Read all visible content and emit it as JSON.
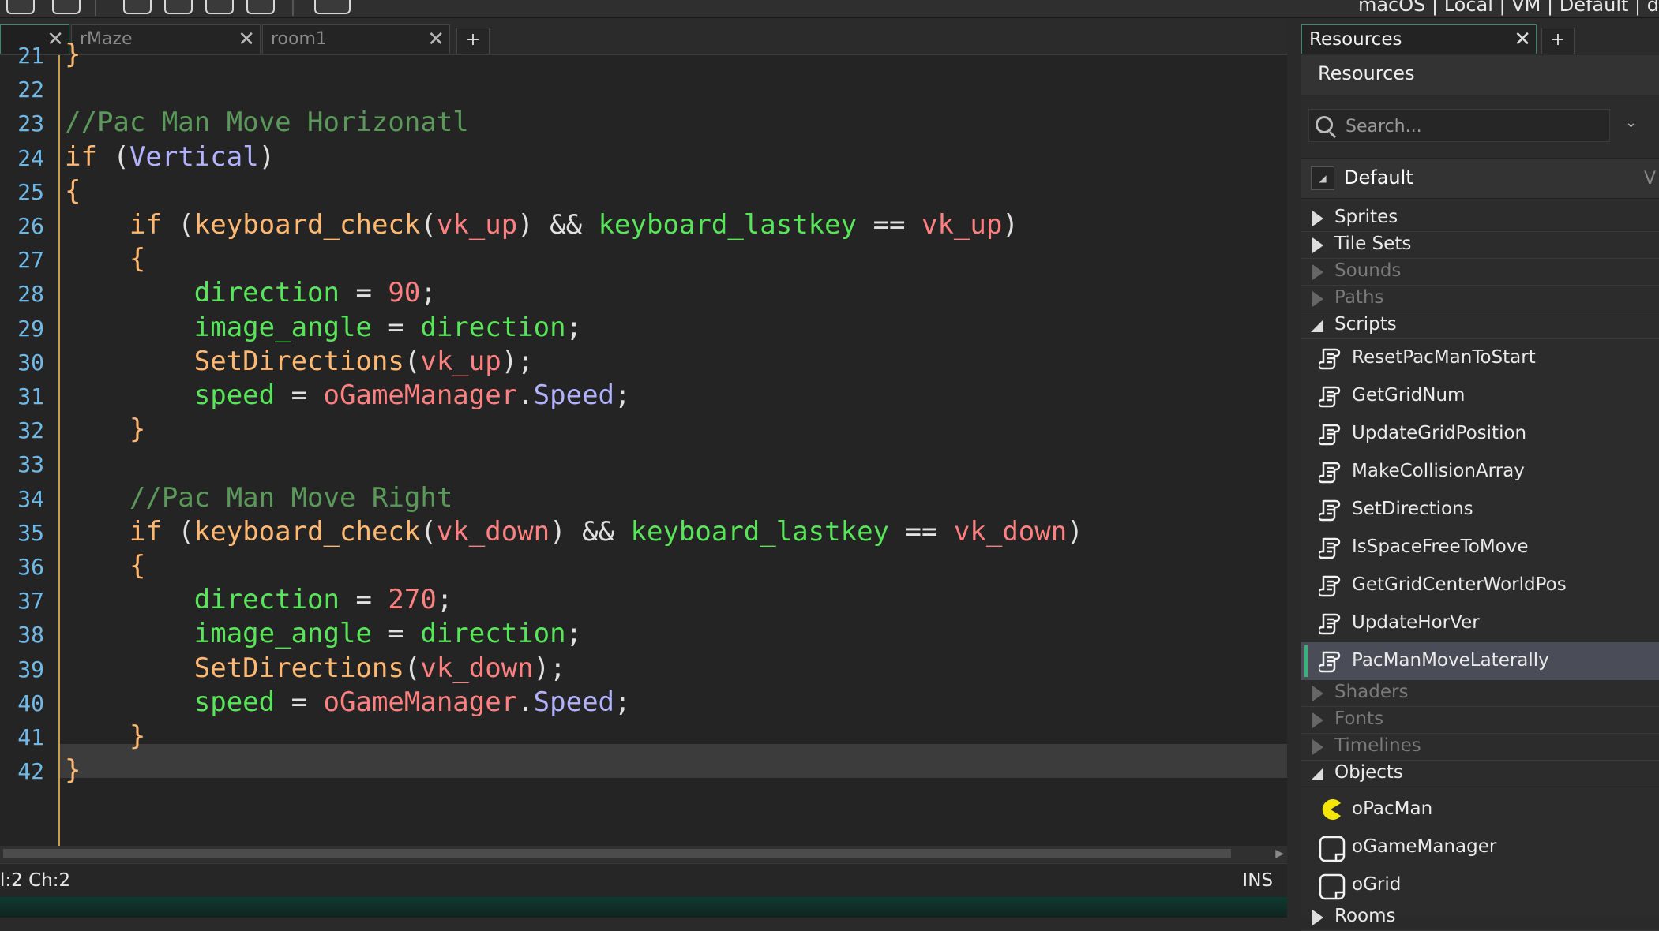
{
  "toolbar": {
    "status_text": "macOS | Local | VM | Default | d"
  },
  "tabs": [
    {
      "label": ""
    },
    {
      "label": "rMaze"
    },
    {
      "label": "room1"
    }
  ],
  "tab_add": "+",
  "code": {
    "lines": [
      {
        "n": "21",
        "tokens": [
          [
            "brk",
            "}"
          ]
        ]
      },
      {
        "n": "22",
        "tokens": []
      },
      {
        "n": "23",
        "tokens": [
          [
            "cmt",
            "//Pac Man Move Horizonatl"
          ]
        ]
      },
      {
        "n": "24",
        "tokens": [
          [
            "kw",
            "if"
          ],
          [
            "op",
            " ("
          ],
          [
            "inst",
            "Vertical"
          ],
          [
            "op",
            ")"
          ]
        ]
      },
      {
        "n": "25",
        "tokens": [
          [
            "brk",
            "{"
          ]
        ]
      },
      {
        "n": "26",
        "tokens": [
          [
            "op",
            "    "
          ],
          [
            "kw",
            "if"
          ],
          [
            "op",
            " ("
          ],
          [
            "fn",
            "keyboard_check"
          ],
          [
            "op",
            "("
          ],
          [
            "cst",
            "vk_up"
          ],
          [
            "op",
            ") && "
          ],
          [
            "var",
            "keyboard_lastkey"
          ],
          [
            "op",
            " == "
          ],
          [
            "cst",
            "vk_up"
          ],
          [
            "op",
            ")"
          ]
        ]
      },
      {
        "n": "27",
        "tokens": [
          [
            "op",
            "    "
          ],
          [
            "brk",
            "{"
          ]
        ]
      },
      {
        "n": "28",
        "tokens": [
          [
            "op",
            "        "
          ],
          [
            "var",
            "direction"
          ],
          [
            "op",
            " = "
          ],
          [
            "num",
            "90"
          ],
          [
            "op",
            ";"
          ]
        ]
      },
      {
        "n": "29",
        "tokens": [
          [
            "op",
            "        "
          ],
          [
            "var",
            "image_angle"
          ],
          [
            "op",
            " = "
          ],
          [
            "var",
            "direction"
          ],
          [
            "op",
            ";"
          ]
        ]
      },
      {
        "n": "30",
        "tokens": [
          [
            "op",
            "        "
          ],
          [
            "fn",
            "SetDirections"
          ],
          [
            "op",
            "("
          ],
          [
            "cst",
            "vk_up"
          ],
          [
            "op",
            ");"
          ]
        ]
      },
      {
        "n": "31",
        "tokens": [
          [
            "op",
            "        "
          ],
          [
            "var",
            "speed"
          ],
          [
            "op",
            " = "
          ],
          [
            "cst",
            "oGameManager"
          ],
          [
            "op",
            "."
          ],
          [
            "inst",
            "Speed"
          ],
          [
            "op",
            ";"
          ]
        ]
      },
      {
        "n": "32",
        "tokens": [
          [
            "op",
            "    "
          ],
          [
            "brk",
            "}"
          ]
        ]
      },
      {
        "n": "33",
        "tokens": []
      },
      {
        "n": "34",
        "tokens": [
          [
            "op",
            "    "
          ],
          [
            "cmt",
            "//Pac Man Move Right"
          ]
        ]
      },
      {
        "n": "35",
        "tokens": [
          [
            "op",
            "    "
          ],
          [
            "kw",
            "if"
          ],
          [
            "op",
            " ("
          ],
          [
            "fn",
            "keyboard_check"
          ],
          [
            "op",
            "("
          ],
          [
            "cst",
            "vk_down"
          ],
          [
            "op",
            ") && "
          ],
          [
            "var",
            "keyboard_lastkey"
          ],
          [
            "op",
            " == "
          ],
          [
            "cst",
            "vk_down"
          ],
          [
            "op",
            ")"
          ]
        ]
      },
      {
        "n": "36",
        "tokens": [
          [
            "op",
            "    "
          ],
          [
            "brk",
            "{"
          ]
        ]
      },
      {
        "n": "37",
        "tokens": [
          [
            "op",
            "        "
          ],
          [
            "var",
            "direction"
          ],
          [
            "op",
            " = "
          ],
          [
            "num",
            "270"
          ],
          [
            "op",
            ";"
          ]
        ]
      },
      {
        "n": "38",
        "tokens": [
          [
            "op",
            "        "
          ],
          [
            "var",
            "image_angle"
          ],
          [
            "op",
            " = "
          ],
          [
            "var",
            "direction"
          ],
          [
            "op",
            ";"
          ]
        ]
      },
      {
        "n": "39",
        "tokens": [
          [
            "op",
            "        "
          ],
          [
            "fn",
            "SetDirections"
          ],
          [
            "op",
            "("
          ],
          [
            "cst",
            "vk_down"
          ],
          [
            "op",
            ");"
          ]
        ]
      },
      {
        "n": "40",
        "tokens": [
          [
            "op",
            "        "
          ],
          [
            "var",
            "speed"
          ],
          [
            "op",
            " = "
          ],
          [
            "cst",
            "oGameManager"
          ],
          [
            "op",
            "."
          ],
          [
            "inst",
            "Speed"
          ],
          [
            "op",
            ";"
          ]
        ]
      },
      {
        "n": "41",
        "tokens": [
          [
            "op",
            "    "
          ],
          [
            "brk",
            "}"
          ]
        ]
      },
      {
        "n": "42",
        "tokens": [
          [
            "brk",
            "}"
          ]
        ]
      }
    ]
  },
  "status": {
    "position": "l:2 Ch:2",
    "mode": "INS"
  },
  "resources": {
    "tab_label": "Resources",
    "header": "Resources",
    "search_placeholder": "Search...",
    "group": "Default",
    "group_suffix": "V",
    "categories": [
      {
        "label": "Sprites",
        "state": "collapsed",
        "dim": false
      },
      {
        "label": "Tile Sets",
        "state": "collapsed",
        "dim": false
      },
      {
        "label": "Sounds",
        "state": "empty",
        "dim": true
      },
      {
        "label": "Paths",
        "state": "empty",
        "dim": true
      },
      {
        "label": "Scripts",
        "state": "expanded",
        "dim": false
      }
    ],
    "scripts": [
      "ResetPacManToStart",
      "GetGridNum",
      "UpdateGridPosition",
      "MakeCollisionArray",
      "SetDirections",
      "IsSpaceFreeToMove",
      "GetGridCenterWorldPos",
      "UpdateHorVer",
      "PacManMoveLaterally"
    ],
    "selected_script": "PacManMoveLaterally",
    "categories_after": [
      {
        "label": "Shaders",
        "state": "empty",
        "dim": true
      },
      {
        "label": "Fonts",
        "state": "empty",
        "dim": true
      },
      {
        "label": "Timelines",
        "state": "empty",
        "dim": true
      },
      {
        "label": "Objects",
        "state": "expanded",
        "dim": false
      }
    ],
    "objects": [
      {
        "label": "oPacMan",
        "icon": "pacman-icon"
      },
      {
        "label": "oGameManager",
        "icon": "object-icon"
      },
      {
        "label": "oGrid",
        "icon": "object-icon"
      }
    ],
    "last_category": "Rooms"
  }
}
